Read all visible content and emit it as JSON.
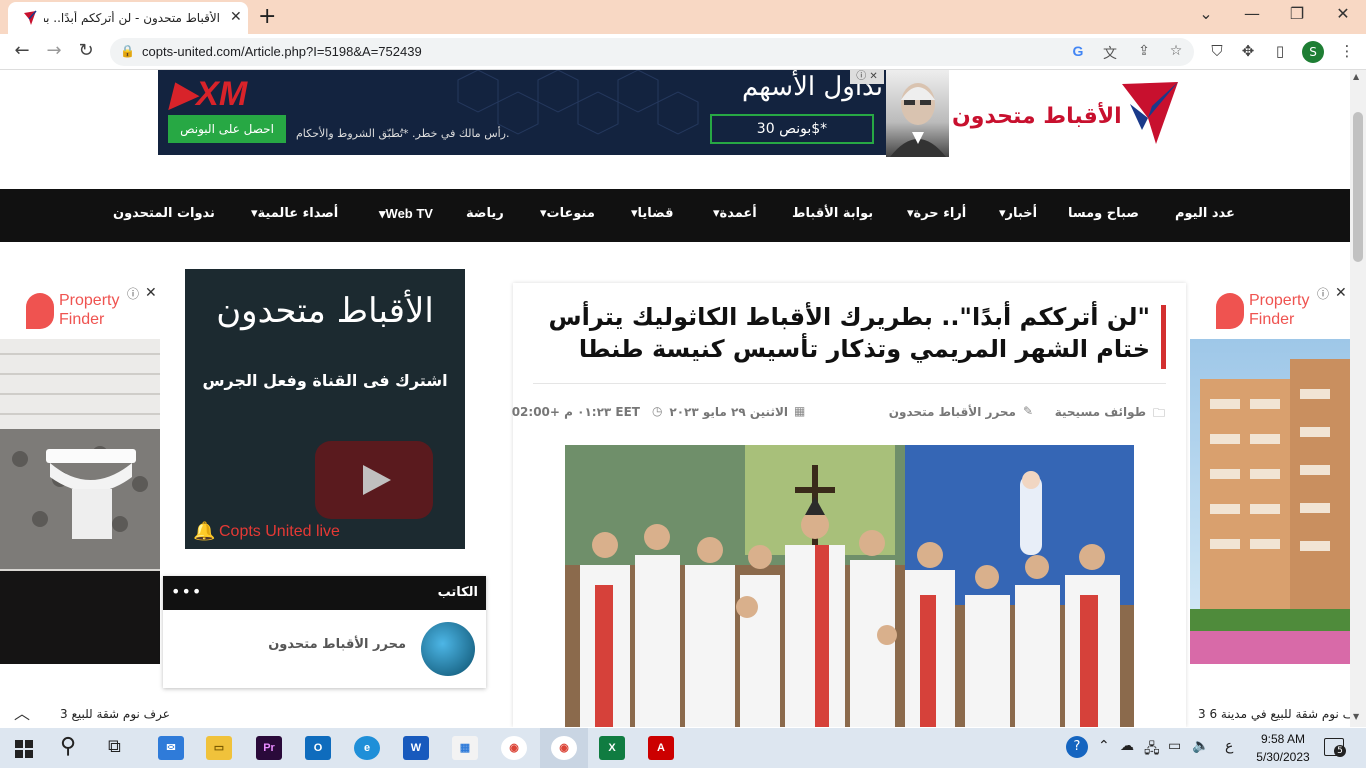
{
  "browser": {
    "tab_title": "الأقباط متحدون - لن أترككم أبدًا.. بطريرك",
    "tab_close": "✕",
    "new_tab": "+",
    "url": "copts-united.com/Article.php?I=5198&A=752439",
    "profile_initial": "S",
    "window_controls": {
      "minimize": "—",
      "restore": "❐",
      "close": "✕",
      "tab_search": "⌄"
    }
  },
  "banner_ad": {
    "brand": "XM",
    "bonus_button": "احصل على البونص",
    "disclaimer": "رأس مالك في خطر. *تُطبّق الشروط والأحكام.",
    "headline": "تداول الأسهم",
    "offer": "بونص 30$*",
    "ad_choices": "ⓘ ✕"
  },
  "site": {
    "logo_text": "الأقباط متحدون"
  },
  "nav": {
    "items": [
      {
        "label": "عدد اليوم",
        "dropdown": false
      },
      {
        "label": "صباح ومسا",
        "dropdown": false
      },
      {
        "label": "أخبار",
        "dropdown": true
      },
      {
        "label": "أراء حرة",
        "dropdown": true
      },
      {
        "label": "بوابة الأقباط",
        "dropdown": false
      },
      {
        "label": "أعمدة",
        "dropdown": true
      },
      {
        "label": "قضايا",
        "dropdown": true
      },
      {
        "label": "منوعات",
        "dropdown": true
      },
      {
        "label": "رياضة",
        "dropdown": false
      },
      {
        "label": "Web TV",
        "dropdown": true
      },
      {
        "label": "أصداء عالمية",
        "dropdown": true
      },
      {
        "label": "ندوات المتحدون",
        "dropdown": false
      }
    ]
  },
  "left_ad": {
    "brand_line1": "Property",
    "brand_line2": "Finder",
    "caption": "3 عرف نوم شقة للبيع"
  },
  "right_ad": {
    "brand_line1": "Property",
    "brand_line2": "Finder",
    "caption": "3 عرف نوم شقة للبيع في مدينة 6"
  },
  "youtube_box": {
    "logo_text": "الأقباط متحدون",
    "subscribe_text": "اشترك فى القناة وفعل الجرس",
    "live_label": "Copts United live"
  },
  "author_widget": {
    "heading": "الكاتب",
    "dots": "•••",
    "author_name": "محرر الأقباط متحدون"
  },
  "article": {
    "title": "\"لن أترككم أبدًا\".. بطريرك الأقباط الكاثوليك يترأس ختام الشهر المريمي وتذكار تأسيس كنيسة طنطا",
    "category": "طوائف مسيحية",
    "author": "محرر الأقباط متحدون",
    "date": "الاثنين ٢٩ مايو ٢٠٢٣",
    "time": "٠١:٢٣ م +02:00 EET"
  },
  "taskbar": {
    "time": "9:58 AM",
    "date": "5/30/2023",
    "notification_count": "5",
    "lang": "ع"
  },
  "colors": {
    "tabbar": "#f8d8c4",
    "navbar": "#111111",
    "accent_red": "#d32f2f",
    "property_finder": "#ef5350"
  }
}
